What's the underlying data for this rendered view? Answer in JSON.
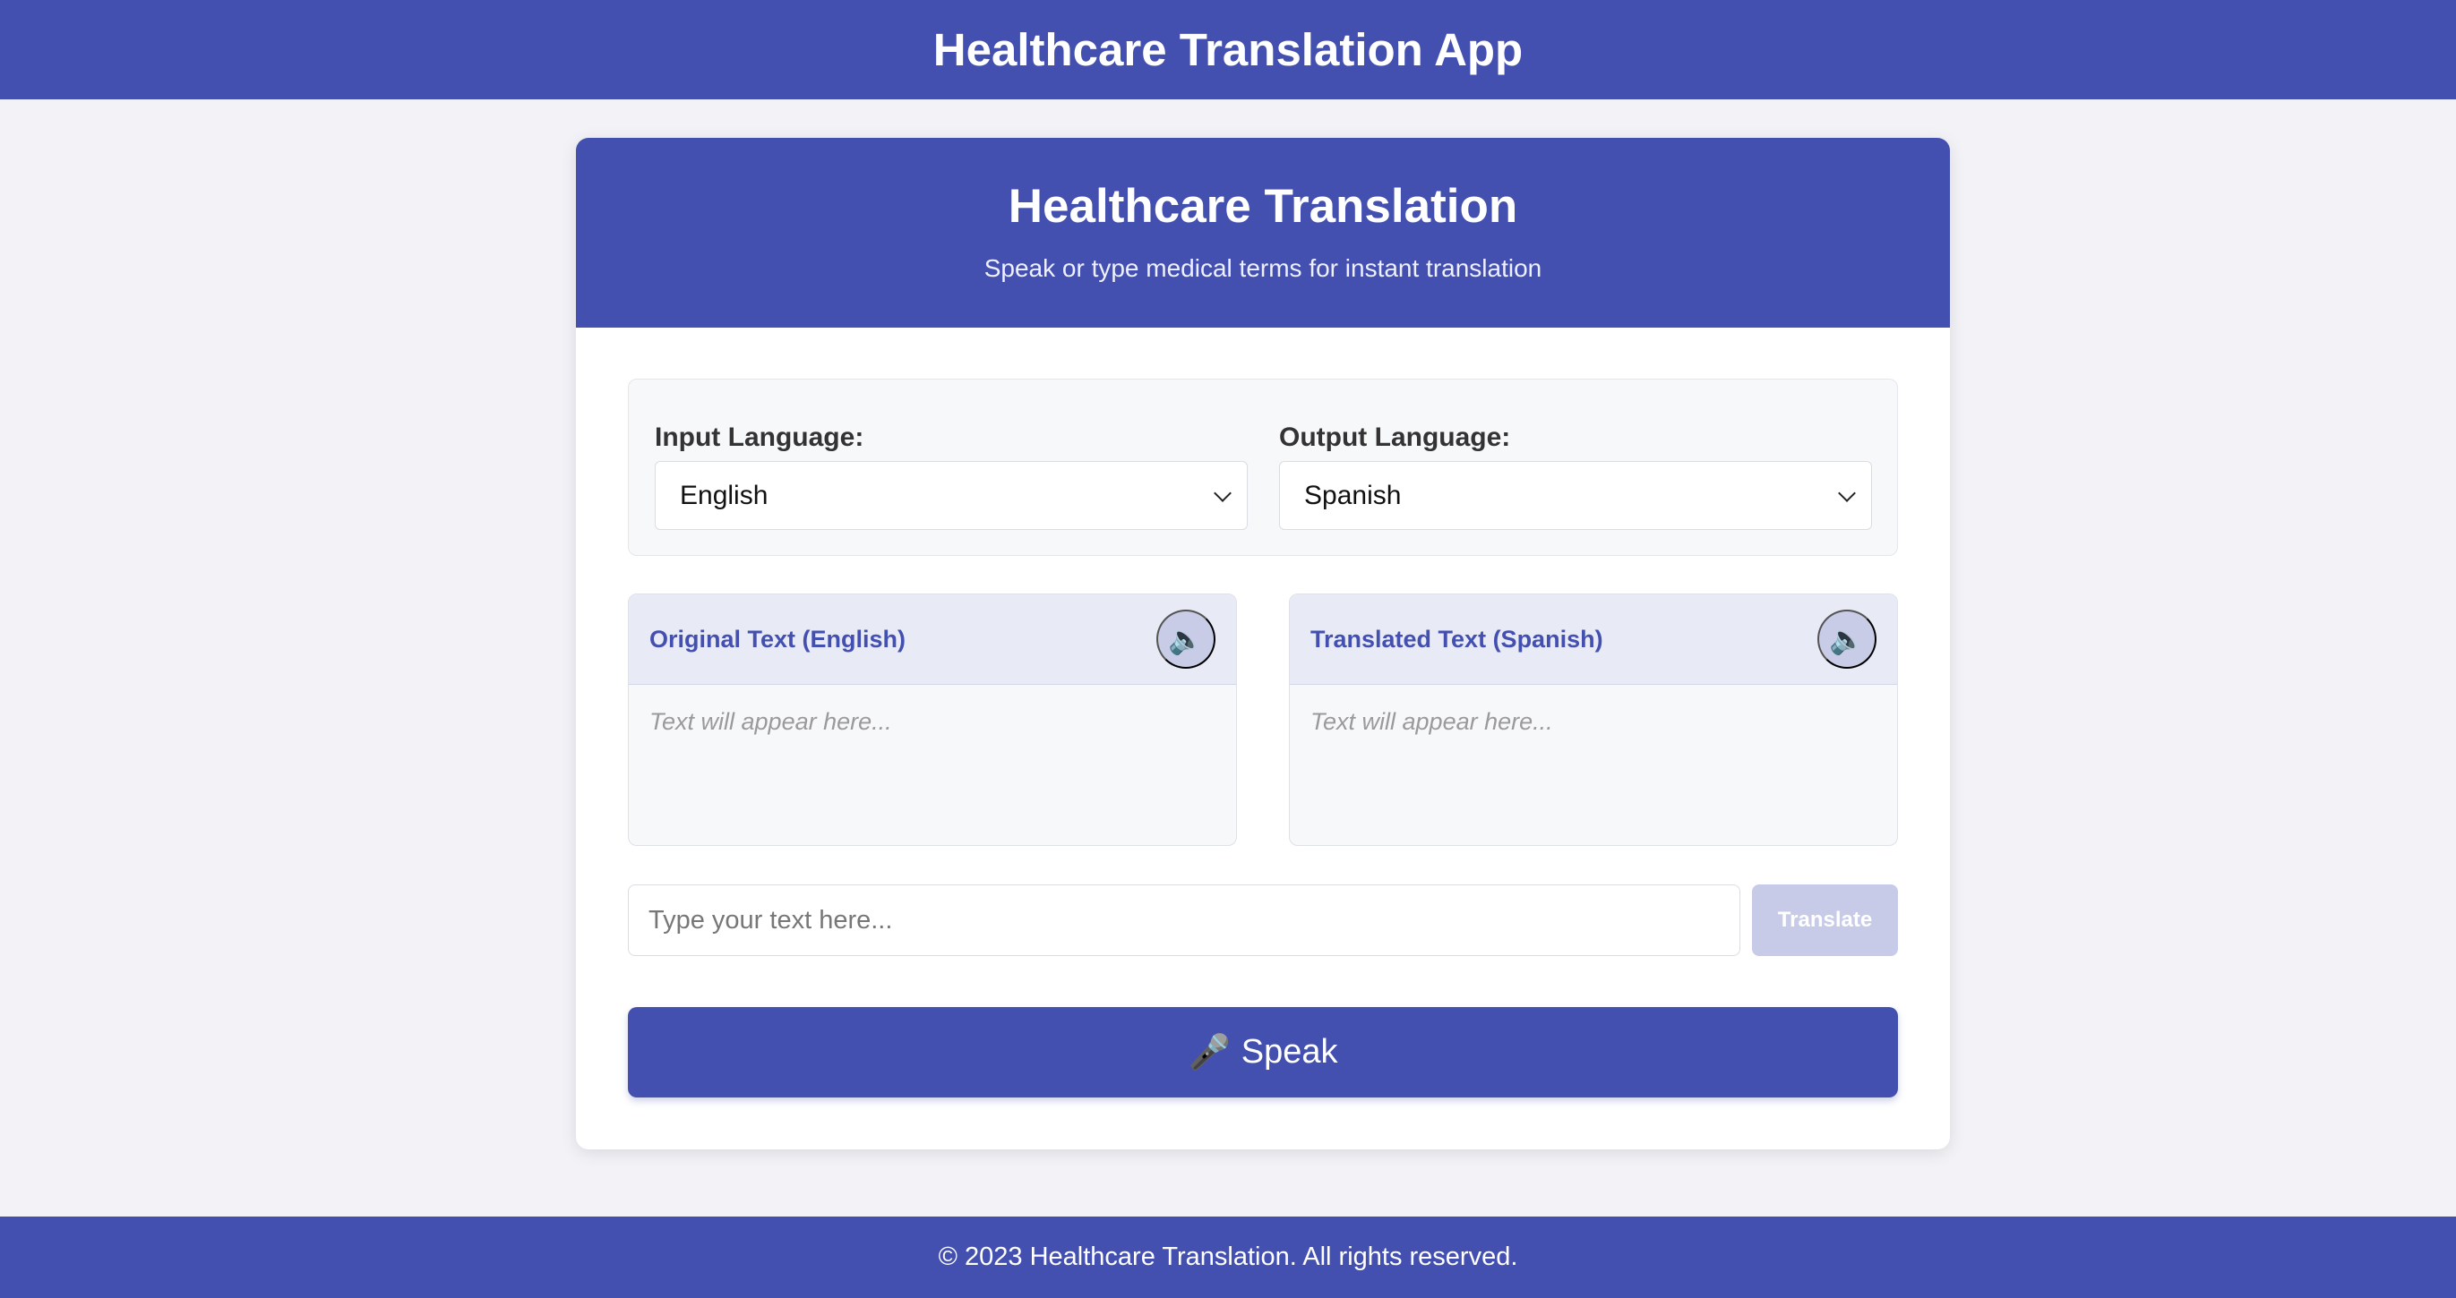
{
  "app": {
    "title": "Healthcare Translation App"
  },
  "card": {
    "title": "Healthcare Translation",
    "subtitle": "Speak or type medical terms for instant translation"
  },
  "languages": {
    "input_label": "Input Language:",
    "input_selected": "English",
    "output_label": "Output Language:",
    "output_selected": "Spanish"
  },
  "original_box": {
    "title": "Original Text (English)",
    "placeholder": "Text will appear here...",
    "speaker_icon": "speaker-icon"
  },
  "translated_box": {
    "title": "Translated Text (Spanish)",
    "placeholder": "Text will appear here...",
    "speaker_icon": "speaker-icon"
  },
  "input": {
    "placeholder": "Type your text here..."
  },
  "buttons": {
    "translate": "Translate",
    "speak_icon": "🎤",
    "speak": "Speak"
  },
  "footer": {
    "text": "© 2023 Healthcare Translation. All rights reserved."
  },
  "colors": {
    "primary": "#4450b0",
    "background": "#f2f2f7",
    "panel": "#f7f8fa",
    "box_header": "#e8eaf6",
    "disabled_button": "#c8cbe8"
  }
}
